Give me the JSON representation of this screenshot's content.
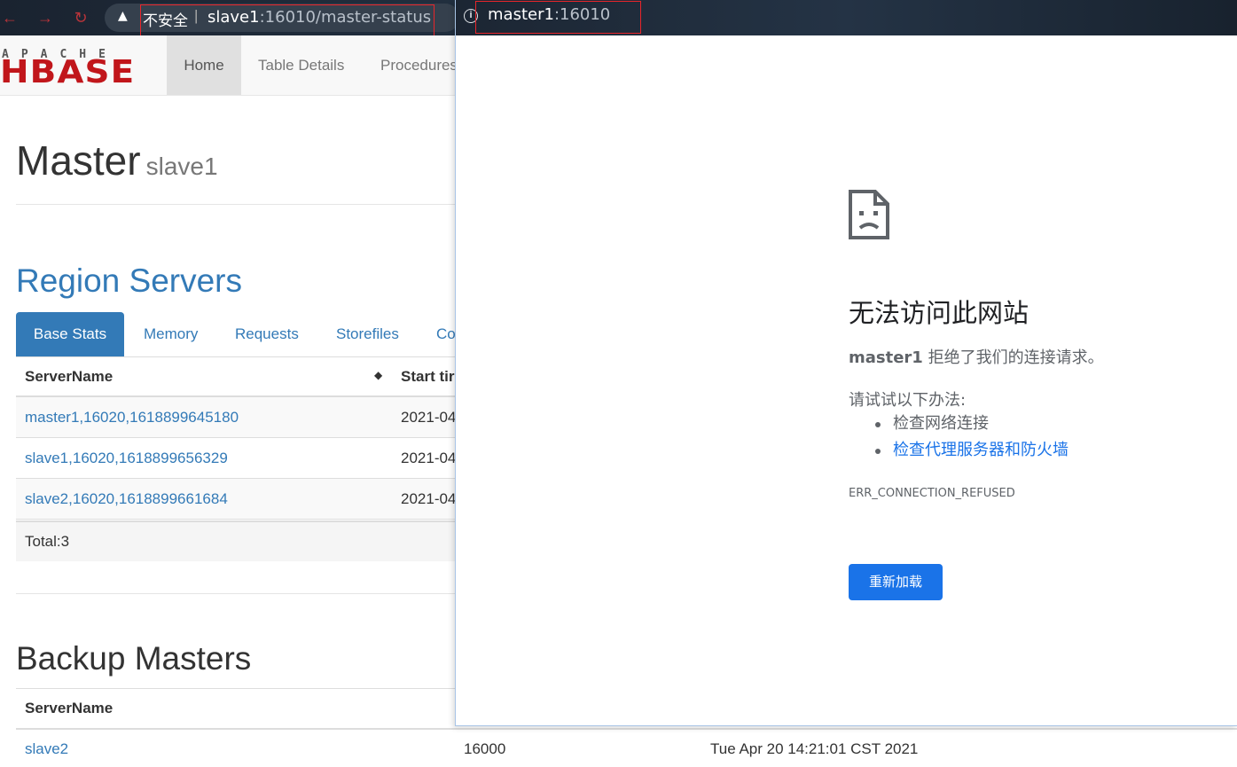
{
  "back_window": {
    "security_label": "不安全",
    "separator": "|",
    "url_host": "slave1",
    "url_rest": ":16010/master-status"
  },
  "hbase": {
    "logo_top": "APACHE",
    "logo_main": "HBASE",
    "nav": [
      "Home",
      "Table Details",
      "Procedures"
    ],
    "master_title": "Master",
    "master_host": "slave1",
    "region_title": "Region Servers",
    "tabs": [
      "Base Stats",
      "Memory",
      "Requests",
      "Storefiles",
      "Co"
    ],
    "table_headers": [
      "ServerName",
      "Start tir"
    ],
    "rows": [
      {
        "server": "master1,16020,1618899645180",
        "start": "2021-04"
      },
      {
        "server": "slave1,16020,1618899656329",
        "start": "2021-04"
      },
      {
        "server": "slave2,16020,1618899661684",
        "start": "2021-04"
      }
    ],
    "total": "Total:3",
    "backup_title": "Backup Masters",
    "backup_header": "ServerName",
    "backup_row": {
      "server": "slave2",
      "port": "16000",
      "start": "Tue Apr 20 14:21:01 CST 2021"
    }
  },
  "popup": {
    "url_host": "master1",
    "url_rest": ":16010",
    "error_title": "无法访问此网站",
    "error_host": "master1",
    "error_desc": " 拒绝了我们的连接请求。",
    "try_label": "请试试以下办法:",
    "suggestions": [
      "检查网络连接",
      "检查代理服务器和防火墙"
    ],
    "error_code": "ERR_CONNECTION_REFUSED",
    "reload_label": "重新加载"
  },
  "colors": {
    "hbase_link": "#337ab7",
    "hbase_logo_red": "#c1161b",
    "chrome_button_blue": "#1a73e8",
    "highlight_box_red": "#e8252a"
  }
}
